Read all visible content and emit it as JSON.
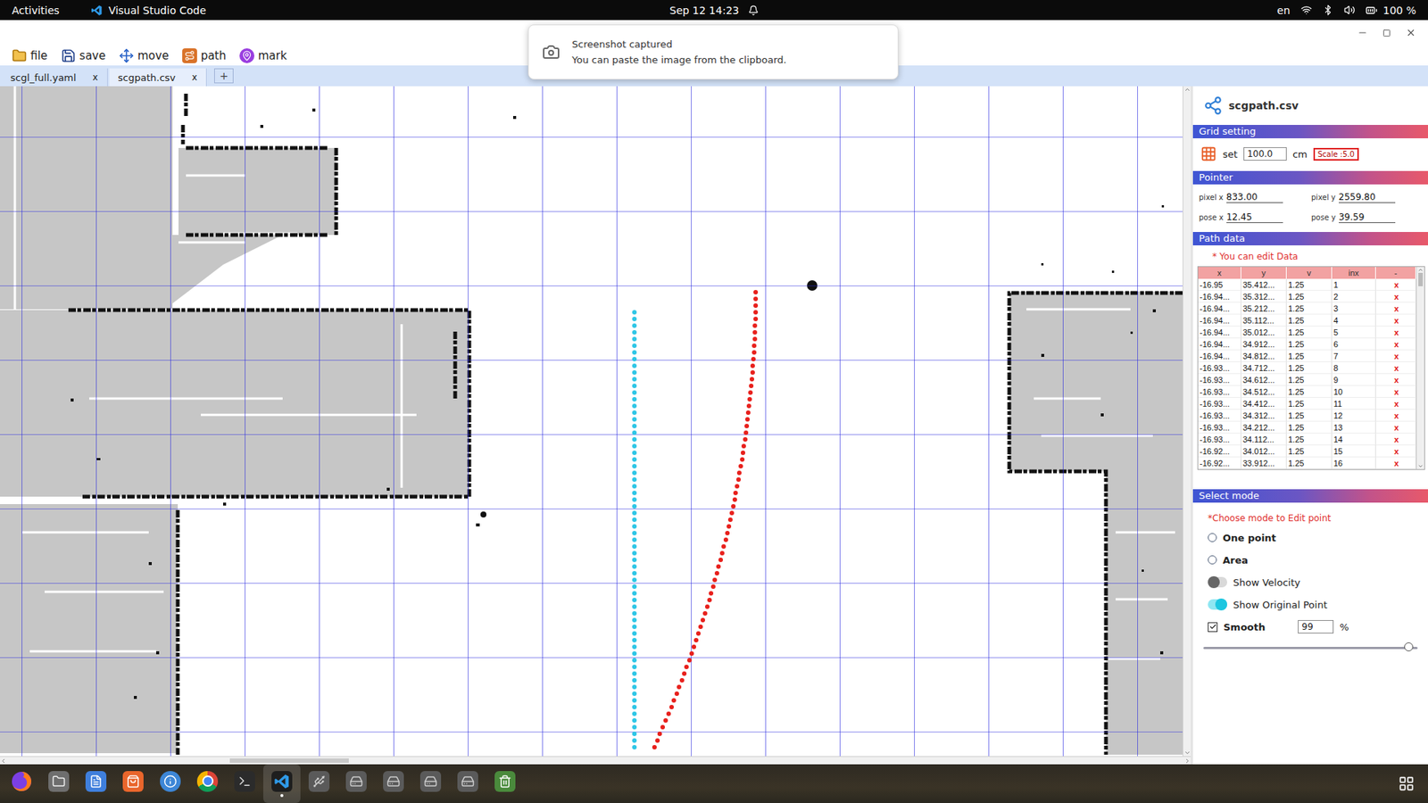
{
  "top_bar": {
    "activities": "Activities",
    "app": "Visual Studio Code",
    "clock": "Sep 12  14:23",
    "language": "en",
    "battery": "100 %"
  },
  "notification": {
    "title": "Screenshot captured",
    "body": "You can paste the image from the clipboard."
  },
  "toolbar": [
    {
      "label": "file"
    },
    {
      "label": "save"
    },
    {
      "label": "move"
    },
    {
      "label": "path"
    },
    {
      "label": "mark"
    }
  ],
  "tabs": [
    {
      "label": "scgl_full.yaml",
      "close": "x",
      "selected": false
    },
    {
      "label": "scgpath.csv",
      "close": "x",
      "selected": true
    }
  ],
  "new_tab": "+",
  "map": {
    "series": [
      {
        "color": "#2ec6e6",
        "x": [
          8.53,
          8.53,
          8.53,
          8.53,
          8.53,
          8.53,
          8.53,
          8.53,
          8.53,
          8.53,
          8.53,
          8.53,
          8.53,
          8.53,
          8.53,
          8.53,
          8.53,
          8.53,
          8.53,
          8.53,
          8.53,
          8.53,
          8.53,
          8.53,
          8.53,
          8.53,
          8.53,
          8.53,
          8.53,
          8.53,
          8.53,
          8.53,
          8.53,
          8.53,
          8.53,
          8.53,
          8.53,
          8.53,
          8.53,
          8.53,
          8.53,
          8.53,
          8.53,
          8.53,
          8.53,
          8.53,
          8.53,
          8.53,
          8.53,
          8.53,
          8.53,
          8.53,
          8.53,
          8.53,
          8.53,
          8.53,
          8.53,
          8.53,
          8.53,
          8.53,
          8.53,
          8.53,
          8.53,
          8.53,
          8.53,
          8.53
        ],
        "y": [
          3.04,
          3.13,
          3.22,
          3.31,
          3.4,
          3.49,
          3.58,
          3.67,
          3.76,
          3.85,
          3.94,
          4.03,
          4.12,
          4.21,
          4.3,
          4.39,
          4.48,
          4.57,
          4.66,
          4.75,
          4.84,
          4.93,
          5.02,
          5.11,
          5.2,
          5.29,
          5.38,
          5.47,
          5.56,
          5.65,
          5.74,
          5.83,
          5.92,
          6.01,
          6.1,
          6.19,
          6.28,
          6.37,
          6.46,
          6.55,
          6.64,
          6.73,
          6.82,
          6.91,
          7.0,
          7.09,
          7.18,
          7.27,
          7.36,
          7.45,
          7.54,
          7.63,
          7.72,
          7.81,
          7.9,
          7.99,
          8.08,
          8.17,
          8.26,
          8.35,
          8.44,
          8.53,
          8.62,
          8.71,
          8.8,
          8.89
        ]
      },
      {
        "color": "#e8201c",
        "x": [
          10.16,
          10.16,
          10.16,
          10.16,
          10.16,
          10.15,
          10.15,
          10.15,
          10.14,
          10.14,
          10.13,
          10.12,
          10.12,
          10.11,
          10.1,
          10.09,
          10.08,
          10.07,
          10.06,
          10.05,
          10.04,
          10.03,
          10.02,
          10.0,
          9.99,
          9.98,
          9.96,
          9.94,
          9.93,
          9.91,
          9.89,
          9.88,
          9.86,
          9.84,
          9.82,
          9.8,
          9.78,
          9.76,
          9.73,
          9.71,
          9.69,
          9.66,
          9.64,
          9.61,
          9.59,
          9.56,
          9.54,
          9.51,
          9.48,
          9.45,
          9.42,
          9.39,
          9.36,
          9.33,
          9.3,
          9.27,
          9.23,
          9.2,
          9.17,
          9.13,
          9.1,
          9.06,
          9.03,
          8.99,
          8.95,
          8.91,
          8.87,
          8.84,
          8.8
        ],
        "y": [
          2.77,
          2.86,
          2.95,
          3.04,
          3.13,
          3.22,
          3.31,
          3.4,
          3.49,
          3.58,
          3.67,
          3.76,
          3.85,
          3.94,
          4.03,
          4.12,
          4.21,
          4.3,
          4.39,
          4.48,
          4.57,
          4.66,
          4.75,
          4.84,
          4.93,
          5.02,
          5.11,
          5.2,
          5.29,
          5.38,
          5.47,
          5.56,
          5.65,
          5.74,
          5.83,
          5.92,
          6.01,
          6.1,
          6.19,
          6.28,
          6.37,
          6.46,
          6.55,
          6.64,
          6.73,
          6.82,
          6.91,
          7.0,
          7.09,
          7.18,
          7.27,
          7.36,
          7.45,
          7.54,
          7.63,
          7.72,
          7.81,
          7.9,
          7.99,
          8.08,
          8.17,
          8.26,
          8.35,
          8.44,
          8.53,
          8.62,
          8.71,
          8.8,
          8.89
        ]
      }
    ]
  },
  "panel": {
    "title": "scgpath.csv",
    "grid": {
      "heading": "Grid setting",
      "set_label": "set",
      "value": "100.0",
      "unit": "cm",
      "scale": "Scale :5.0"
    },
    "pointer": {
      "heading": "Pointer",
      "fields": [
        {
          "label": "pixel x",
          "value": "833.00"
        },
        {
          "label": "pixel y",
          "value": "2559.80"
        },
        {
          "label": "pose x",
          "value": "12.45"
        },
        {
          "label": "pose y",
          "value": "39.59"
        }
      ]
    },
    "path_data": {
      "heading": "Path data",
      "note": "* You can edit Data",
      "columns": [
        "x",
        "y",
        "v",
        "inx",
        "-"
      ],
      "rows": [
        {
          "x": "-16.95",
          "y": "35.412...",
          "v": "1.25",
          "inx": "1",
          "delete": "x"
        },
        {
          "x": "-16.94...",
          "y": "35.312...",
          "v": "1.25",
          "inx": "2",
          "delete": "x"
        },
        {
          "x": "-16.94...",
          "y": "35.212...",
          "v": "1.25",
          "inx": "3",
          "delete": "x"
        },
        {
          "x": "-16.94...",
          "y": "35.112...",
          "v": "1.25",
          "inx": "4",
          "delete": "x"
        },
        {
          "x": "-16.94...",
          "y": "35.012...",
          "v": "1.25",
          "inx": "5",
          "delete": "x"
        },
        {
          "x": "-16.94...",
          "y": "34.912...",
          "v": "1.25",
          "inx": "6",
          "delete": "x"
        },
        {
          "x": "-16.94...",
          "y": "34.812...",
          "v": "1.25",
          "inx": "7",
          "delete": "x"
        },
        {
          "x": "-16.93...",
          "y": "34.712...",
          "v": "1.25",
          "inx": "8",
          "delete": "x"
        },
        {
          "x": "-16.93...",
          "y": "34.612...",
          "v": "1.25",
          "inx": "9",
          "delete": "x"
        },
        {
          "x": "-16.93...",
          "y": "34.512...",
          "v": "1.25",
          "inx": "10",
          "delete": "x"
        },
        {
          "x": "-16.93...",
          "y": "34.412...",
          "v": "1.25",
          "inx": "11",
          "delete": "x"
        },
        {
          "x": "-16.93...",
          "y": "34.312...",
          "v": "1.25",
          "inx": "12",
          "delete": "x"
        },
        {
          "x": "-16.93...",
          "y": "34.212...",
          "v": "1.25",
          "inx": "13",
          "delete": "x"
        },
        {
          "x": "-16.93...",
          "y": "34.112...",
          "v": "1.25",
          "inx": "14",
          "delete": "x"
        },
        {
          "x": "-16.92...",
          "y": "34.012...",
          "v": "1.25",
          "inx": "15",
          "delete": "x"
        },
        {
          "x": "-16.92...",
          "y": "33.912...",
          "v": "1.25",
          "inx": "16",
          "delete": "x"
        }
      ]
    },
    "select_mode": {
      "heading": "Select mode",
      "note": "*Choose mode to Edit point",
      "options": [
        {
          "kind": "radio",
          "label": "One point",
          "selected": false
        },
        {
          "kind": "radio",
          "label": "Area",
          "selected": false
        },
        {
          "kind": "toggle",
          "label": "Show Velocity",
          "on": false
        },
        {
          "kind": "toggle",
          "label": "Show Original Point",
          "on": true
        },
        {
          "kind": "checkbox",
          "label": "Smooth",
          "checked": true,
          "value": "99",
          "unit": "%"
        }
      ],
      "slider": {
        "level": 0.96
      }
    }
  },
  "dock": [
    {
      "running": false,
      "selected": false
    },
    {
      "running": false,
      "selected": false
    },
    {
      "running": false,
      "selected": false
    },
    {
      "running": false,
      "selected": false
    },
    {
      "running": false,
      "selected": false
    },
    {
      "running": false,
      "selected": false
    },
    {
      "running": false,
      "selected": false
    },
    {
      "running": true,
      "selected": true
    },
    {
      "running": false,
      "selected": false
    },
    {
      "running": false,
      "selected": false
    },
    {
      "running": false,
      "selected": false
    },
    {
      "running": false,
      "selected": false
    },
    {
      "running": false,
      "selected": false
    },
    {
      "running": false,
      "selected": false
    }
  ]
}
